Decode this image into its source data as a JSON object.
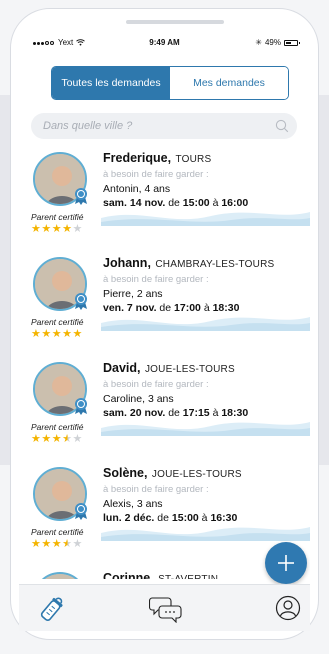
{
  "status_bar": {
    "carrier": "Yext",
    "time": "9:49 AM",
    "battery_percent": "49%",
    "battery_level": 0.49
  },
  "segment": {
    "all_label": "Toutes les demandes",
    "mine_label": "Mes demandes",
    "active": "all"
  },
  "search": {
    "placeholder": "Dans quelle ville ?"
  },
  "requests": [
    {
      "name": "Frederique,",
      "city": "TOURS",
      "need": "à besoin de faire garder :",
      "child": "Antonin, 4 ans",
      "date": "sam. 14 nov.",
      "word_from": "de",
      "start": "15:00",
      "word_to": "à",
      "end": "16:00",
      "certified_label": "Parent certifié",
      "rating": 4
    },
    {
      "name": "Johann,",
      "city": "CHAMBRAY-LES-TOURS",
      "need": "à besoin de faire garder :",
      "child": "Pierre, 2 ans",
      "date": "ven. 7 nov.",
      "word_from": "de",
      "start": "17:00",
      "word_to": "à",
      "end": "18:30",
      "certified_label": "Parent certifié",
      "rating": 5
    },
    {
      "name": "David,",
      "city": "JOUE-LES-TOURS",
      "need": "à besoin de faire garder :",
      "child": "Caroline, 3 ans",
      "date": "sam. 20 nov.",
      "word_from": "de",
      "start": "17:15",
      "word_to": "à",
      "end": "18:30",
      "certified_label": "Parent certifié",
      "rating": 3.5
    },
    {
      "name": "Solène,",
      "city": "JOUE-LES-TOURS",
      "need": "à besoin de faire garder :",
      "child": "Alexis, 3 ans",
      "date": "lun. 2 déc.",
      "word_from": "de",
      "start": "15:00",
      "word_to": "à",
      "end": "16:30",
      "certified_label": "Parent certifié",
      "rating": 3.5
    },
    {
      "name": "Corinne,",
      "city": "ST-AVERTIN",
      "need": "",
      "child": "",
      "date": "",
      "word_from": "",
      "start": "",
      "word_to": "",
      "end": "",
      "certified_label": "",
      "rating": 0
    }
  ],
  "tab_bar": {
    "items": [
      {
        "icon": "baby-bottle-icon"
      },
      {
        "icon": "chat-bubbles-icon"
      },
      {
        "icon": "profile-icon"
      }
    ]
  },
  "colors": {
    "primary": "#2e78ad",
    "avatar_ring": "#5faed3",
    "star": "#f4b400",
    "wave": "#cfe5f2"
  }
}
